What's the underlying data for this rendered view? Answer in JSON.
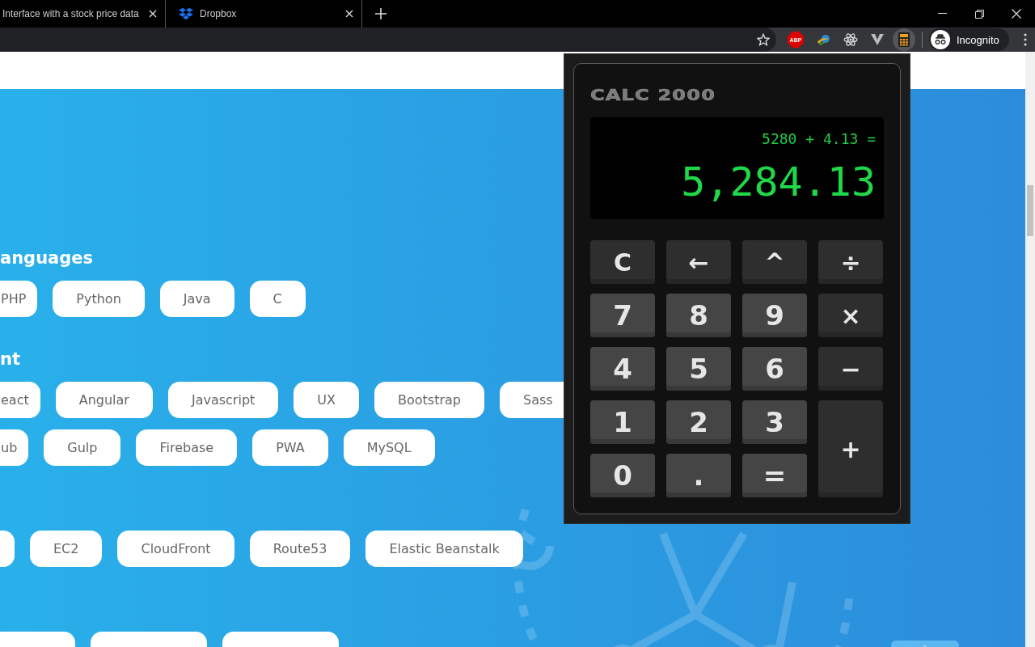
{
  "browser": {
    "tabs": [
      {
        "title": "Interface with a stock price data",
        "selected": false,
        "kind": "plain"
      },
      {
        "title": "Dropbox",
        "selected": false,
        "kind": "dropbox"
      }
    ],
    "toolbar": {
      "adblock_label": "ABP",
      "profile_label": "Incognito"
    }
  },
  "page": {
    "sections": [
      {
        "heading": "anguages",
        "rows": [
          [
            {
              "kind": "edge",
              "label": "PHP"
            },
            {
              "kind": "tag",
              "label": "Python"
            },
            {
              "kind": "tag",
              "label": "Java"
            },
            {
              "kind": "tag",
              "label": "C"
            }
          ]
        ]
      },
      {
        "heading": "nt",
        "rows": [
          [
            {
              "kind": "edge",
              "label": "eact"
            },
            {
              "kind": "tag",
              "label": "Angular"
            },
            {
              "kind": "tag",
              "label": "Javascript"
            },
            {
              "kind": "tag",
              "label": "UX"
            },
            {
              "kind": "tag",
              "label": "Bootstrap"
            },
            {
              "kind": "tag",
              "label": "Sass"
            }
          ],
          [
            {
              "kind": "edge",
              "label": "ub"
            },
            {
              "kind": "tag",
              "label": "Gulp"
            },
            {
              "kind": "tag",
              "label": "Firebase"
            },
            {
              "kind": "tag",
              "label": "PWA"
            },
            {
              "kind": "tag",
              "label": "MySQL"
            }
          ]
        ]
      },
      {
        "rows": [
          [
            {
              "kind": "stub"
            },
            {
              "kind": "tag",
              "label": "EC2"
            },
            {
              "kind": "tag",
              "label": "CloudFront"
            },
            {
              "kind": "tag",
              "label": "Route53"
            },
            {
              "kind": "tag",
              "label": "Elastic Beanstalk"
            }
          ]
        ]
      },
      {
        "rows": [
          [
            {
              "kind": "stub"
            },
            {
              "kind": "stub"
            },
            {
              "kind": "stub"
            }
          ]
        ]
      }
    ]
  },
  "calculator": {
    "title": "CALC 2000",
    "expression": "5280 + 4.13 =",
    "result": "5,284.13",
    "keys": [
      {
        "label": "C",
        "kind": "op"
      },
      {
        "label": "←",
        "kind": "op"
      },
      {
        "label": "^",
        "kind": "op"
      },
      {
        "label": "÷",
        "kind": "op"
      },
      {
        "label": "7",
        "kind": "digit"
      },
      {
        "label": "8",
        "kind": "digit"
      },
      {
        "label": "9",
        "kind": "digit"
      },
      {
        "label": "×",
        "kind": "op"
      },
      {
        "label": "4",
        "kind": "digit"
      },
      {
        "label": "5",
        "kind": "digit"
      },
      {
        "label": "6",
        "kind": "digit"
      },
      {
        "label": "−",
        "kind": "op"
      },
      {
        "label": "1",
        "kind": "digit"
      },
      {
        "label": "2",
        "kind": "digit"
      },
      {
        "label": "3",
        "kind": "digit"
      },
      {
        "label": "+",
        "kind": "tall"
      },
      {
        "label": "0",
        "kind": "digit"
      },
      {
        "label": ".",
        "kind": "digit"
      },
      {
        "label": "=",
        "kind": "digit"
      }
    ]
  }
}
